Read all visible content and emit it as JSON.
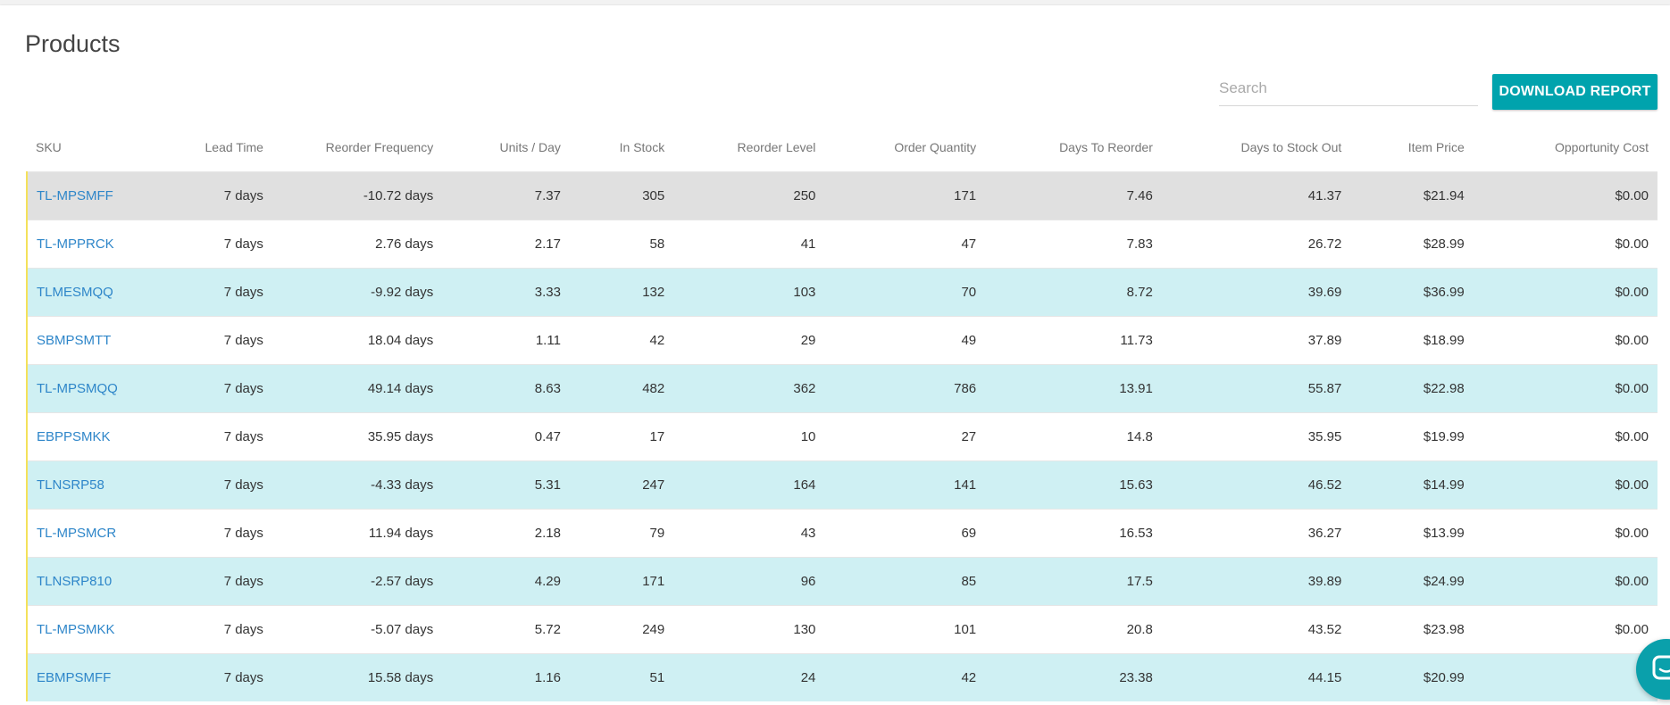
{
  "page": {
    "title": "Products"
  },
  "search": {
    "placeholder": "Search",
    "value": ""
  },
  "toolbar": {
    "download_label": "DOWNLOAD REPORT"
  },
  "colors": {
    "accent": "#00a3ad",
    "link": "#2e86c9",
    "row_stripe": "#cff0f3",
    "row_selected": "#e0e0e0",
    "row_marker": "#f4e15b"
  },
  "table": {
    "columns": [
      "SKU",
      "Lead Time",
      "Reorder Frequency",
      "Units / Day",
      "In Stock",
      "Reorder Level",
      "Order Quantity",
      "Days To Reorder",
      "Days to Stock Out",
      "Item Price",
      "Opportunity Cost"
    ],
    "rows": [
      [
        "TL-MPSMFF",
        "7 days",
        "-10.72 days",
        "7.37",
        "305",
        "250",
        "171",
        "7.46",
        "41.37",
        "$21.94",
        "$0.00"
      ],
      [
        "TL-MPPRCK",
        "7 days",
        "2.76 days",
        "2.17",
        "58",
        "41",
        "47",
        "7.83",
        "26.72",
        "$28.99",
        "$0.00"
      ],
      [
        "TLMESMQQ",
        "7 days",
        "-9.92 days",
        "3.33",
        "132",
        "103",
        "70",
        "8.72",
        "39.69",
        "$36.99",
        "$0.00"
      ],
      [
        "SBMPSMTT",
        "7 days",
        "18.04 days",
        "1.11",
        "42",
        "29",
        "49",
        "11.73",
        "37.89",
        "$18.99",
        "$0.00"
      ],
      [
        "TL-MPSMQQ",
        "7 days",
        "49.14 days",
        "8.63",
        "482",
        "362",
        "786",
        "13.91",
        "55.87",
        "$22.98",
        "$0.00"
      ],
      [
        "EBPPSMKK",
        "7 days",
        "35.95 days",
        "0.47",
        "17",
        "10",
        "27",
        "14.8",
        "35.95",
        "$19.99",
        "$0.00"
      ],
      [
        "TLNSRP58",
        "7 days",
        "-4.33 days",
        "5.31",
        "247",
        "164",
        "141",
        "15.63",
        "46.52",
        "$14.99",
        "$0.00"
      ],
      [
        "TL-MPSMCR",
        "7 days",
        "11.94 days",
        "2.18",
        "79",
        "43",
        "69",
        "16.53",
        "36.27",
        "$13.99",
        "$0.00"
      ],
      [
        "TLNSRP810",
        "7 days",
        "-2.57 days",
        "4.29",
        "171",
        "96",
        "85",
        "17.5",
        "39.89",
        "$24.99",
        "$0.00"
      ],
      [
        "TL-MPSMKK",
        "7 days",
        "-5.07 days",
        "5.72",
        "249",
        "130",
        "101",
        "20.8",
        "43.52",
        "$23.98",
        "$0.00"
      ],
      [
        "EBMPSMFF",
        "7 days",
        "15.58 days",
        "1.16",
        "51",
        "24",
        "42",
        "23.38",
        "44.15",
        "$20.99",
        ""
      ]
    ]
  },
  "chat": {
    "icon": "chat-bubble-icon"
  }
}
